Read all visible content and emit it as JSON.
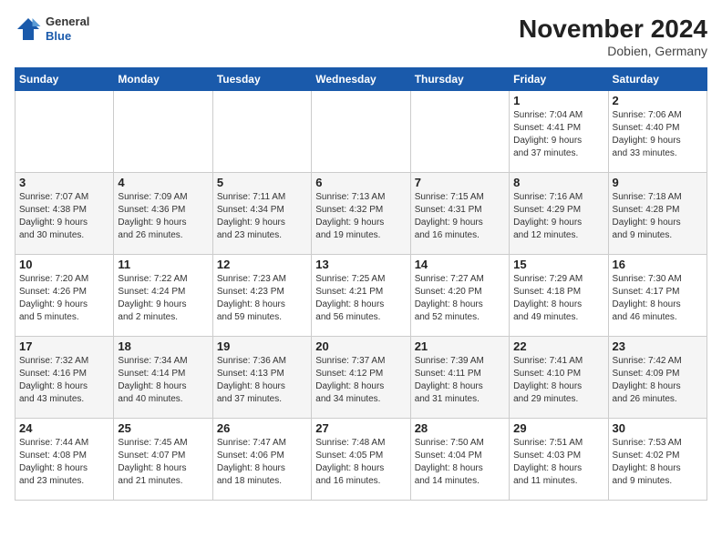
{
  "header": {
    "logo_general": "General",
    "logo_blue": "Blue",
    "title": "November 2024",
    "subtitle": "Dobien, Germany"
  },
  "columns": [
    "Sunday",
    "Monday",
    "Tuesday",
    "Wednesday",
    "Thursday",
    "Friday",
    "Saturday"
  ],
  "weeks": [
    [
      {
        "day": "",
        "info": ""
      },
      {
        "day": "",
        "info": ""
      },
      {
        "day": "",
        "info": ""
      },
      {
        "day": "",
        "info": ""
      },
      {
        "day": "",
        "info": ""
      },
      {
        "day": "1",
        "info": "Sunrise: 7:04 AM\nSunset: 4:41 PM\nDaylight: 9 hours\nand 37 minutes."
      },
      {
        "day": "2",
        "info": "Sunrise: 7:06 AM\nSunset: 4:40 PM\nDaylight: 9 hours\nand 33 minutes."
      }
    ],
    [
      {
        "day": "3",
        "info": "Sunrise: 7:07 AM\nSunset: 4:38 PM\nDaylight: 9 hours\nand 30 minutes."
      },
      {
        "day": "4",
        "info": "Sunrise: 7:09 AM\nSunset: 4:36 PM\nDaylight: 9 hours\nand 26 minutes."
      },
      {
        "day": "5",
        "info": "Sunrise: 7:11 AM\nSunset: 4:34 PM\nDaylight: 9 hours\nand 23 minutes."
      },
      {
        "day": "6",
        "info": "Sunrise: 7:13 AM\nSunset: 4:32 PM\nDaylight: 9 hours\nand 19 minutes."
      },
      {
        "day": "7",
        "info": "Sunrise: 7:15 AM\nSunset: 4:31 PM\nDaylight: 9 hours\nand 16 minutes."
      },
      {
        "day": "8",
        "info": "Sunrise: 7:16 AM\nSunset: 4:29 PM\nDaylight: 9 hours\nand 12 minutes."
      },
      {
        "day": "9",
        "info": "Sunrise: 7:18 AM\nSunset: 4:28 PM\nDaylight: 9 hours\nand 9 minutes."
      }
    ],
    [
      {
        "day": "10",
        "info": "Sunrise: 7:20 AM\nSunset: 4:26 PM\nDaylight: 9 hours\nand 5 minutes."
      },
      {
        "day": "11",
        "info": "Sunrise: 7:22 AM\nSunset: 4:24 PM\nDaylight: 9 hours\nand 2 minutes."
      },
      {
        "day": "12",
        "info": "Sunrise: 7:23 AM\nSunset: 4:23 PM\nDaylight: 8 hours\nand 59 minutes."
      },
      {
        "day": "13",
        "info": "Sunrise: 7:25 AM\nSunset: 4:21 PM\nDaylight: 8 hours\nand 56 minutes."
      },
      {
        "day": "14",
        "info": "Sunrise: 7:27 AM\nSunset: 4:20 PM\nDaylight: 8 hours\nand 52 minutes."
      },
      {
        "day": "15",
        "info": "Sunrise: 7:29 AM\nSunset: 4:18 PM\nDaylight: 8 hours\nand 49 minutes."
      },
      {
        "day": "16",
        "info": "Sunrise: 7:30 AM\nSunset: 4:17 PM\nDaylight: 8 hours\nand 46 minutes."
      }
    ],
    [
      {
        "day": "17",
        "info": "Sunrise: 7:32 AM\nSunset: 4:16 PM\nDaylight: 8 hours\nand 43 minutes."
      },
      {
        "day": "18",
        "info": "Sunrise: 7:34 AM\nSunset: 4:14 PM\nDaylight: 8 hours\nand 40 minutes."
      },
      {
        "day": "19",
        "info": "Sunrise: 7:36 AM\nSunset: 4:13 PM\nDaylight: 8 hours\nand 37 minutes."
      },
      {
        "day": "20",
        "info": "Sunrise: 7:37 AM\nSunset: 4:12 PM\nDaylight: 8 hours\nand 34 minutes."
      },
      {
        "day": "21",
        "info": "Sunrise: 7:39 AM\nSunset: 4:11 PM\nDaylight: 8 hours\nand 31 minutes."
      },
      {
        "day": "22",
        "info": "Sunrise: 7:41 AM\nSunset: 4:10 PM\nDaylight: 8 hours\nand 29 minutes."
      },
      {
        "day": "23",
        "info": "Sunrise: 7:42 AM\nSunset: 4:09 PM\nDaylight: 8 hours\nand 26 minutes."
      }
    ],
    [
      {
        "day": "24",
        "info": "Sunrise: 7:44 AM\nSunset: 4:08 PM\nDaylight: 8 hours\nand 23 minutes."
      },
      {
        "day": "25",
        "info": "Sunrise: 7:45 AM\nSunset: 4:07 PM\nDaylight: 8 hours\nand 21 minutes."
      },
      {
        "day": "26",
        "info": "Sunrise: 7:47 AM\nSunset: 4:06 PM\nDaylight: 8 hours\nand 18 minutes."
      },
      {
        "day": "27",
        "info": "Sunrise: 7:48 AM\nSunset: 4:05 PM\nDaylight: 8 hours\nand 16 minutes."
      },
      {
        "day": "28",
        "info": "Sunrise: 7:50 AM\nSunset: 4:04 PM\nDaylight: 8 hours\nand 14 minutes."
      },
      {
        "day": "29",
        "info": "Sunrise: 7:51 AM\nSunset: 4:03 PM\nDaylight: 8 hours\nand 11 minutes."
      },
      {
        "day": "30",
        "info": "Sunrise: 7:53 AM\nSunset: 4:02 PM\nDaylight: 8 hours\nand 9 minutes."
      }
    ]
  ]
}
